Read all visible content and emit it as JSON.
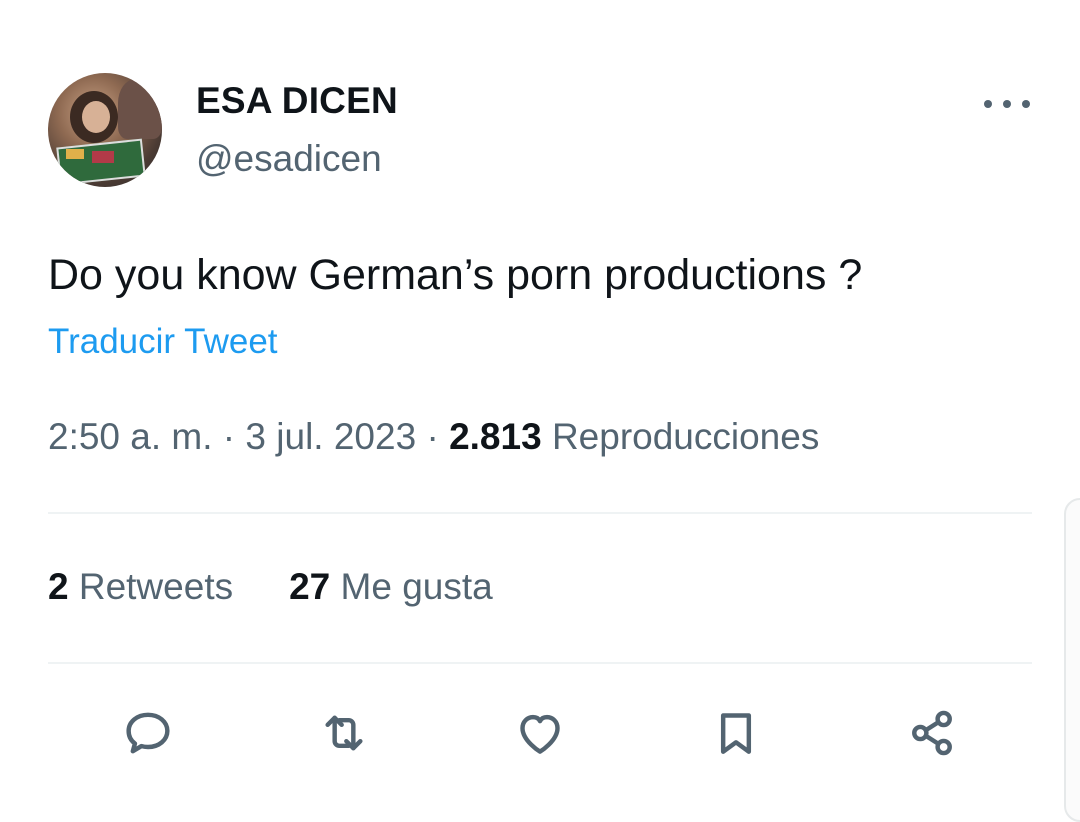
{
  "author": {
    "display_name": "ESA DICEN",
    "handle": "@esadicen"
  },
  "tweet": {
    "text": "Do you know German’s porn productions ?",
    "translate_label": "Traducir Tweet"
  },
  "meta": {
    "time": "2:50 a. m.",
    "separator": " · ",
    "date": "3 jul. 2023",
    "views_count": "2.813",
    "views_label": "Reproducciones"
  },
  "stats": {
    "retweets_count": "2",
    "retweets_label": "Retweets",
    "likes_count": "27",
    "likes_label": "Me gusta"
  },
  "icons": {
    "more": "more-horizontal-icon",
    "reply": "reply-icon",
    "retweet": "retweet-icon",
    "like": "like-icon",
    "bookmark": "bookmark-icon",
    "share": "share-icon"
  },
  "colors": {
    "text": "#0f1419",
    "secondary": "#536471",
    "link": "#1d9bf0",
    "divider": "#eff3f4"
  }
}
